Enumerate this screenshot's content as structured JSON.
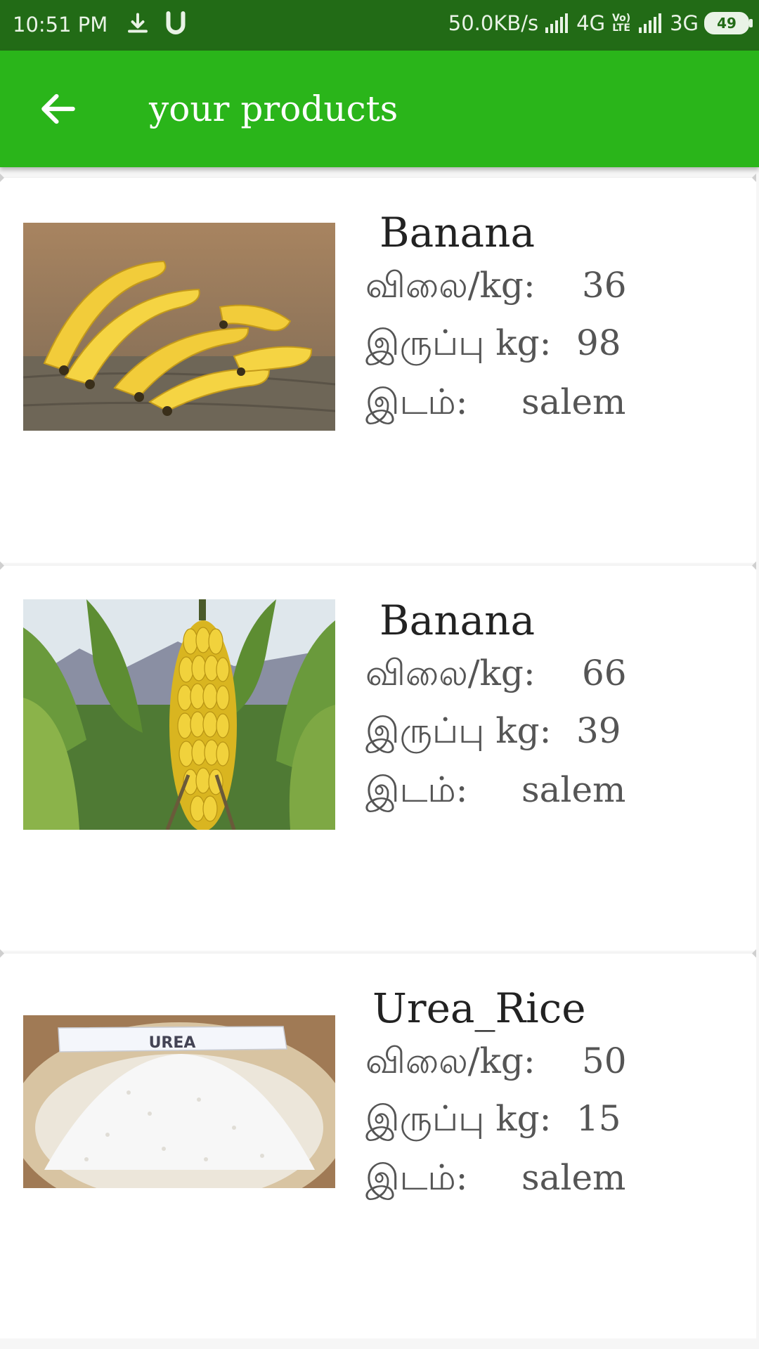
{
  "status_bar": {
    "time": "10:51 PM",
    "network_speed": "50.0KB/s",
    "network_1": "4G",
    "volte_label": "Vo) LTE",
    "network_2": "3G",
    "battery_level": "49",
    "icons": [
      "download-icon",
      "u-app-icon",
      "signal-icon",
      "signal-icon",
      "battery-icon"
    ]
  },
  "app_bar": {
    "title": "your products",
    "back_icon": "arrow-left-icon",
    "color": "#2ab51a"
  },
  "labels": {
    "price": "விலை/kg:",
    "stock": "இருப்பு kg:",
    "location": "இடம்:"
  },
  "products": [
    {
      "name": "Banana",
      "price": "36",
      "stock": "98",
      "location": "salem",
      "image": "bananas-on-wood"
    },
    {
      "name": "Banana",
      "price": "66",
      "stock": "39",
      "location": "salem",
      "image": "banana-tree-bunch"
    },
    {
      "name": "Urea_Rice",
      "price": "50",
      "stock": "15",
      "location": "salem",
      "image": "urea-bowl"
    }
  ]
}
